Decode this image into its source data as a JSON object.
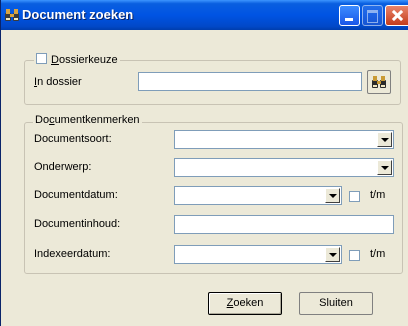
{
  "window": {
    "title": "Document zoeken",
    "icon": "binoculars-icon"
  },
  "dossier_group": {
    "checkbox_label_u": "D",
    "checkbox_label_rest": "ossierkeuze",
    "checked": false,
    "in_dossier_label_u": "I",
    "in_dossier_label_rest": "n dossier",
    "in_dossier_value": "",
    "browse_icon": "binoculars-icon"
  },
  "kenmerken_group": {
    "legend_pre": "Do",
    "legend_u": "c",
    "legend_rest": "umentkenmerken",
    "rows": [
      {
        "label": "Documentsoort:",
        "value": "",
        "type": "combo"
      },
      {
        "label": "Onderwerp:",
        "value": "",
        "type": "combo"
      },
      {
        "label": "Documentdatum:",
        "value": "",
        "type": "combo",
        "tm_label": "t/m",
        "tm_checked": false
      },
      {
        "label": "Documentinhoud:",
        "value": "",
        "type": "text"
      },
      {
        "label": "Indexeerdatum:",
        "value": "",
        "type": "combo",
        "tm_label": "t/m",
        "tm_checked": false
      }
    ]
  },
  "buttons": {
    "search_u": "Z",
    "search_rest": "oeken",
    "close": "Sluiten"
  }
}
